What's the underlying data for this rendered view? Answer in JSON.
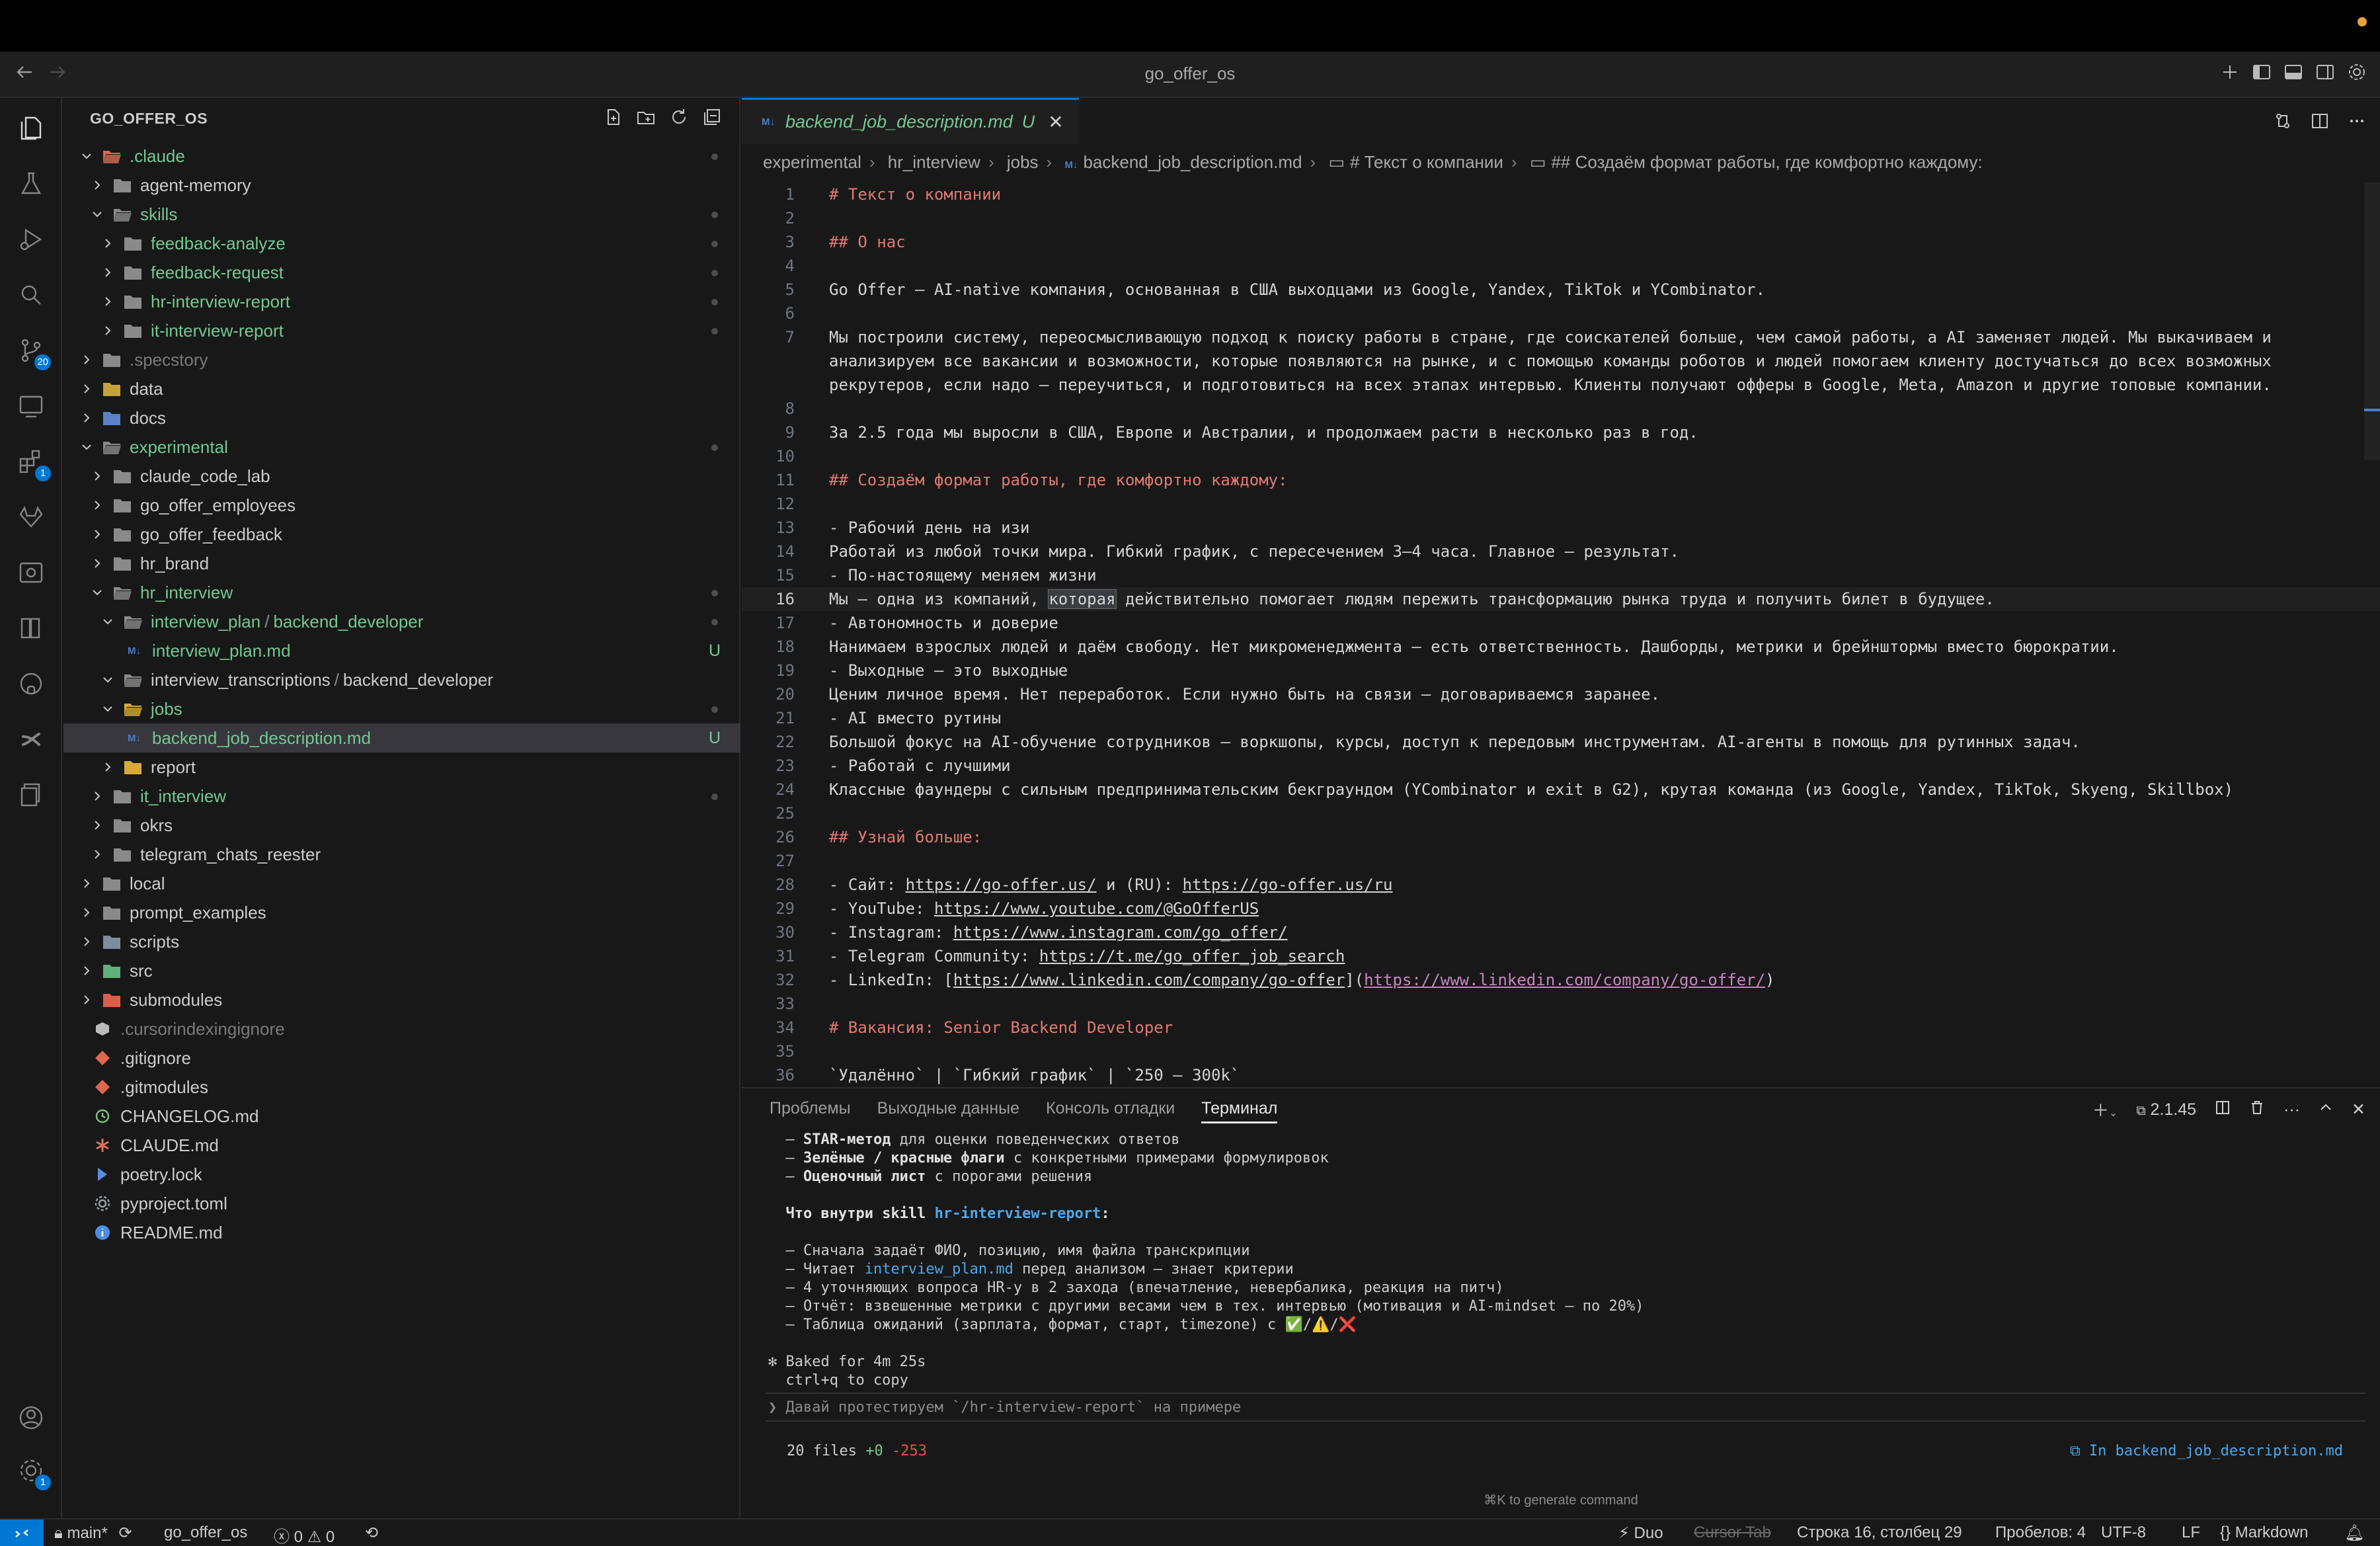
{
  "window": {
    "title": "go_offer_os"
  },
  "activity_bar": {
    "scm_badge": "20",
    "extensions_badge": "1",
    "settings_badge": "1"
  },
  "explorer": {
    "header": "GO_OFFER_OS",
    "items": [
      {
        "label": ".claude",
        "kind": "folder-open",
        "depth": 0,
        "color": "git",
        "dot": true,
        "icon": "claude"
      },
      {
        "label": "agent-memory",
        "kind": "folder",
        "depth": 1
      },
      {
        "label": "skills",
        "kind": "folder-open",
        "depth": 1,
        "color": "git",
        "dot": true
      },
      {
        "label": "feedback-analyze",
        "kind": "folder",
        "depth": 2,
        "color": "git",
        "dot": true
      },
      {
        "label": "feedback-request",
        "kind": "folder",
        "depth": 2,
        "color": "git",
        "dot": true
      },
      {
        "label": "hr-interview-report",
        "kind": "folder",
        "depth": 2,
        "color": "git",
        "dot": true
      },
      {
        "label": "it-interview-report",
        "kind": "folder",
        "depth": 2,
        "color": "git",
        "dot": true
      },
      {
        "label": ".specstory",
        "kind": "folder",
        "depth": 0,
        "color": "dim"
      },
      {
        "label": "data",
        "kind": "folder",
        "depth": 0,
        "icon": "data"
      },
      {
        "label": "docs",
        "kind": "folder",
        "depth": 0,
        "icon": "docs"
      },
      {
        "label": "experimental",
        "kind": "folder-open",
        "depth": 0,
        "color": "git",
        "dot": true
      },
      {
        "label": "claude_code_lab",
        "kind": "folder",
        "depth": 1
      },
      {
        "label": "go_offer_employees",
        "kind": "folder",
        "depth": 1
      },
      {
        "label": "go_offer_feedback",
        "kind": "folder",
        "depth": 1
      },
      {
        "label": "hr_brand",
        "kind": "folder",
        "depth": 1
      },
      {
        "label": "hr_interview",
        "kind": "folder-open",
        "depth": 1,
        "color": "git",
        "dot": true
      },
      {
        "label": "interview_plan",
        "label2": "backend_developer",
        "kind": "folder-open",
        "depth": 2,
        "color": "git",
        "dot": true
      },
      {
        "label": "interview_plan.md",
        "kind": "md",
        "depth": 3,
        "color": "git",
        "status": "U"
      },
      {
        "label": "interview_transcriptions",
        "label2": "backend_developer",
        "kind": "folder-open",
        "depth": 2
      },
      {
        "label": "jobs",
        "kind": "folder-open-yellow",
        "depth": 2,
        "color": "git",
        "dot": true
      },
      {
        "label": "backend_job_description.md",
        "kind": "md",
        "depth": 3,
        "color": "git",
        "status": "U",
        "selected": true
      },
      {
        "label": "report",
        "kind": "folder-yellow",
        "depth": 2
      },
      {
        "label": "it_interview",
        "kind": "folder",
        "depth": 1,
        "color": "git",
        "dot": true
      },
      {
        "label": "okrs",
        "kind": "folder",
        "depth": 1
      },
      {
        "label": "telegram_chats_reester",
        "kind": "folder",
        "depth": 1
      },
      {
        "label": "local",
        "kind": "folder",
        "depth": 0
      },
      {
        "label": "prompt_examples",
        "kind": "folder",
        "depth": 0
      },
      {
        "label": "scripts",
        "kind": "folder",
        "depth": 0,
        "icon": "scripts"
      },
      {
        "label": "src",
        "kind": "folder",
        "depth": 0,
        "icon": "src"
      },
      {
        "label": "submodules",
        "kind": "folder",
        "depth": 0,
        "icon": "submodules"
      },
      {
        "label": ".cursorindexingignore",
        "kind": "file-cube",
        "depth": 0,
        "color": "dim"
      },
      {
        "label": ".gitignore",
        "kind": "file-git",
        "depth": 0
      },
      {
        "label": ".gitmodules",
        "kind": "file-git",
        "depth": 0
      },
      {
        "label": "CHANGELOG.md",
        "kind": "file-changelog",
        "depth": 0
      },
      {
        "label": "CLAUDE.md",
        "kind": "file-claude",
        "depth": 0
      },
      {
        "label": "poetry.lock",
        "kind": "file-poetry",
        "depth": 0
      },
      {
        "label": "pyproject.toml",
        "kind": "file-gear",
        "depth": 0
      },
      {
        "label": "README.md",
        "kind": "file-info",
        "depth": 0
      }
    ]
  },
  "editor": {
    "tab": {
      "name": "backend_job_description.md",
      "status": "U"
    },
    "breadcrumb": [
      "experimental",
      "hr_interview",
      "jobs",
      "backend_job_description.md",
      "# Текст о компании",
      "## Создаём формат работы, где комфортно каждому:"
    ],
    "current_line": 16,
    "lines": [
      {
        "n": "1",
        "t": "# Текст о компании",
        "k": "h"
      },
      {
        "n": "2",
        "t": ""
      },
      {
        "n": "3",
        "t": "## О нас",
        "k": "h"
      },
      {
        "n": "4",
        "t": ""
      },
      {
        "n": "5",
        "t": "Go Offer — AI-native компания, основанная в США выходцами из Google, Yandex, TikTok и YCombinator."
      },
      {
        "n": "6",
        "t": ""
      },
      {
        "n": "7",
        "t": "Мы построили систему, переосмысливающую подход к поиску работы в стране, где соискателей больше, чем самой работы, а AI заменяет людей. Мы выкачиваем и"
      },
      {
        "n": "",
        "t": "анализируем все вакансии и возможности, которые появляются на рынке, и с помощью команды роботов и людей помогаем клиенту достучаться до всех возможных"
      },
      {
        "n": "",
        "t": "рекрутеров, если надо — переучиться, и подготовиться на всех этапах интервью. Клиенты получают офферы в Google, Meta, Amazon и другие топовые компании."
      },
      {
        "n": "8",
        "t": ""
      },
      {
        "n": "9",
        "t": "За 2.5 года мы выросли в США, Европе и Австралии, и продолжаем расти в несколько раз в год."
      },
      {
        "n": "10",
        "t": ""
      },
      {
        "n": "11",
        "t": "## Создаём формат работы, где комфортно каждому:",
        "k": "h"
      },
      {
        "n": "12",
        "t": ""
      },
      {
        "n": "13",
        "t": "- Рабочий день на изи"
      },
      {
        "n": "14",
        "t": "Работай из любой точки мира. Гибкий график, с пересечением 3–4 часа. Главное — результат."
      },
      {
        "n": "15",
        "t": "- По-настоящему меняем жизни"
      },
      {
        "n": "16",
        "t": "Мы — одна из компаний, которая действительно помогает людям пережить трансформацию рынка труда и получить билет в будущее.",
        "k": "cur"
      },
      {
        "n": "17",
        "t": "- Автономность и доверие"
      },
      {
        "n": "18",
        "t": "Нанимаем взрослых людей и даём свободу. Нет микроменеджмента — есть ответственность. Дашборды, метрики и брейнштормы вместо бюрократии."
      },
      {
        "n": "19",
        "t": "- Выходные — это выходные"
      },
      {
        "n": "20",
        "t": "Ценим личное время. Нет переработок. Если нужно быть на связи — договариваемся заранее."
      },
      {
        "n": "21",
        "t": "- AI вместо рутины"
      },
      {
        "n": "22",
        "t": "Большой фокус на AI-обучение сотрудников — воркшопы, курсы, доступ к передовым инструментам. AI-агенты в помощь для рутинных задач."
      },
      {
        "n": "23",
        "t": "- Работай с лучшими"
      },
      {
        "n": "24",
        "t": "Классные фаундеры с сильным предпринимательским бекграундом (YCombinator и exit в G2), крутая команда (из Google, Yandex, TikTok, Skyeng, Skillbox)"
      },
      {
        "n": "25",
        "t": ""
      },
      {
        "n": "26",
        "t": "## Узнай больше:",
        "k": "h"
      },
      {
        "n": "27",
        "t": ""
      },
      {
        "n": "28",
        "t": "- Сайт: ",
        "l1": "https://go-offer.us/",
        "m": " и (RU): ",
        "l2": "https://go-offer.us/ru",
        "k": "links"
      },
      {
        "n": "29",
        "t": "- YouTube: ",
        "l1": "https://www.youtube.com/@GoOfferUS",
        "k": "links"
      },
      {
        "n": "30",
        "t": "- Instagram: ",
        "l1": "https://www.instagram.com/go_offer/",
        "k": "links"
      },
      {
        "n": "31",
        "t": "- Telegram Community: ",
        "l1": "https://t.me/go_offer_job_search",
        "k": "links"
      },
      {
        "n": "32",
        "t": "- LinkedIn: [",
        "l1": "https://www.linkedin.com/company/go-offer",
        "m": "](",
        "l3": "https://www.linkedin.com/company/go-offer/",
        "e": ")",
        "k": "links"
      },
      {
        "n": "33",
        "t": ""
      },
      {
        "n": "34",
        "t": "# Вакансия: Senior Backend Developer",
        "k": "h"
      },
      {
        "n": "35",
        "t": ""
      },
      {
        "n": "36",
        "t": "`Удалённо` | `Гибкий график` | `250 – 300k`"
      }
    ]
  },
  "panel": {
    "tabs": [
      "Проблемы",
      "Выходные данные",
      "Консоль отладки",
      "Терминал"
    ],
    "active_tab": "Терминал",
    "version": "2.1.45",
    "terminal_lines": [
      [
        {
          "t": "  – "
        },
        {
          "t": "STAR-метод",
          "c": "b"
        },
        {
          "t": " для оценки поведенческих ответов"
        }
      ],
      [
        {
          "t": "  – "
        },
        {
          "t": "Зелёные / красные флаги",
          "c": "b"
        },
        {
          "t": " с конкретными примерами формулировок"
        }
      ],
      [
        {
          "t": "  – "
        },
        {
          "t": "Оценочный лист",
          "c": "b"
        },
        {
          "t": " с порогами решения"
        }
      ],
      [
        {
          "t": ""
        }
      ],
      [
        {
          "t": "  "
        },
        {
          "t": "Что внутри skill ",
          "c": "b"
        },
        {
          "t": "hr-interview-report",
          "c": "cb"
        },
        {
          "t": ":",
          "c": "b"
        }
      ],
      [
        {
          "t": ""
        }
      ],
      [
        {
          "t": "  – Сначала задаёт ФИО, позицию, имя файла транскрипции"
        }
      ],
      [
        {
          "t": "  – Читает "
        },
        {
          "t": "interview_plan.md",
          "c": "c"
        },
        {
          "t": " перед анализом — знает критерии"
        }
      ],
      [
        {
          "t": "  – 4 уточняющих вопроса HR-у в 2 захода (впечатление, невербалика, реакция на питч)"
        }
      ],
      [
        {
          "t": "  – Отчёт: взвешенные метрики с другими весами чем в тех. интервью (мотивация и AI-mindset — по 20%)"
        }
      ],
      [
        {
          "t": "  – Таблица ожиданий (зарплата, формат, старт, timezone) с "
        },
        {
          "t": "✅",
          "c": "g"
        },
        {
          "t": "/"
        },
        {
          "t": "⚠️",
          "c": "y"
        },
        {
          "t": "/"
        },
        {
          "t": "❌",
          "c": "r"
        }
      ],
      [
        {
          "t": ""
        }
      ],
      [
        {
          "t": "✻ Baked for 4m 25s"
        }
      ],
      [
        {
          "t": "  ctrl+q to copy"
        }
      ]
    ],
    "prompt": "❯ Давай протестируем `/hr-interview-report` на примере",
    "files_summary": {
      "prefix": "20 files ",
      "plus": "+0",
      "minus": "-253"
    },
    "in_file": "⧉ In backend_job_description.md",
    "hint": "⌘K to generate command"
  },
  "status_bar": {
    "branch": "main*",
    "project": "go_offer_os",
    "errors": "0",
    "warnings": "0",
    "duo": "Duo",
    "cursor_tab": "Cursor Tab",
    "position": "Строка 16, столбец 29",
    "indent": "Пробелов: 4",
    "encoding": "UTF-8",
    "eol": "LF",
    "language": "Markdown"
  }
}
